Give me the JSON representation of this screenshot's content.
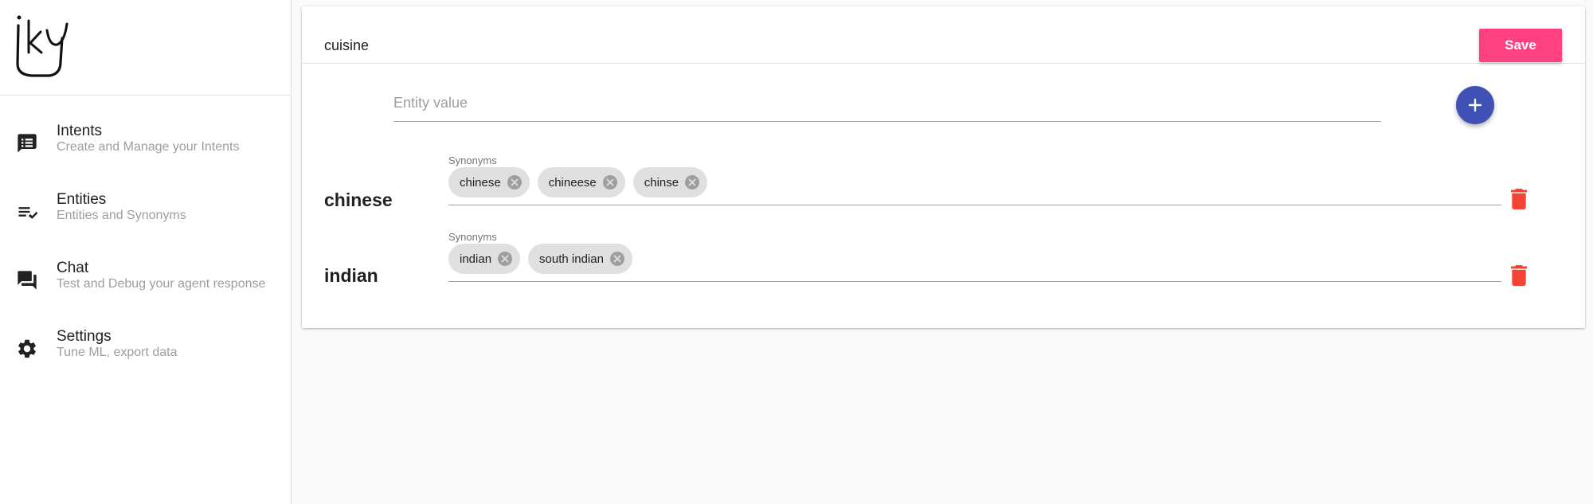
{
  "sidebar": {
    "logo_text": "iKY",
    "items": [
      {
        "title": "Intents",
        "subtitle": "Create and Manage your Intents",
        "icon": "intents-icon"
      },
      {
        "title": "Entities",
        "subtitle": "Entities and Synonyms",
        "icon": "entities-icon"
      },
      {
        "title": "Chat",
        "subtitle": "Test and Debug your agent response",
        "icon": "chat-icon"
      },
      {
        "title": "Settings",
        "subtitle": "Tune ML, export data",
        "icon": "gear-icon"
      }
    ]
  },
  "entity": {
    "name": "cuisine",
    "save_label": "Save",
    "value_placeholder": "Entity value",
    "values": [
      {
        "name": "chinese",
        "synonyms_label": "Synonyms",
        "synonyms": [
          "chinese",
          "chineese",
          "chinse"
        ]
      },
      {
        "name": "indian",
        "synonyms_label": "Synonyms",
        "synonyms": [
          "indian",
          "south indian"
        ]
      }
    ]
  },
  "colors": {
    "accent_pink": "#ff4081",
    "primary_indigo": "#3f51b5",
    "delete_red": "#f44336"
  }
}
